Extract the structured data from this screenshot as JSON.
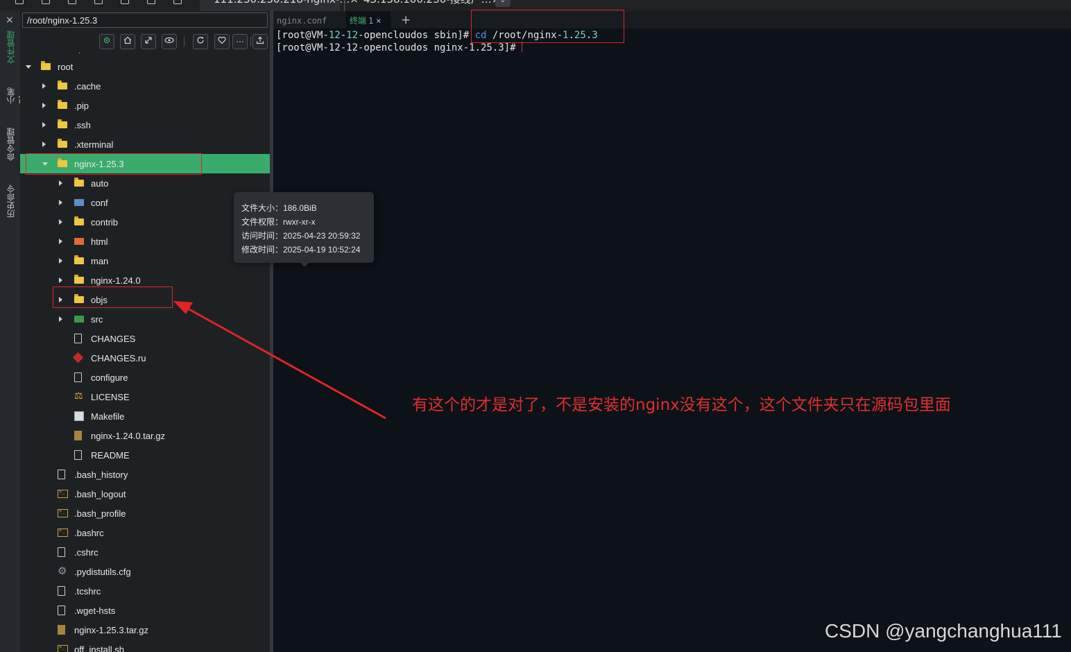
{
  "window_tabs": [
    {
      "label": "111.230.230.218-nginx-…×"
    },
    {
      "label": "43.138.100.230-接线厂…×"
    }
  ],
  "sidebar_rail": {
    "close_glyph": "×",
    "files_label": "文件管理",
    "notes_label": "小笔记",
    "commands_label": "命令管理",
    "history_label": "历史命令"
  },
  "file_panel": {
    "path": "/root/nginx-1.25.3",
    "toolbar_icons": [
      "locate-icon",
      "home-icon",
      "collapse-icon",
      "eye-icon",
      "refresh-icon",
      "heart-icon",
      "more-icon",
      "upload-icon"
    ],
    "tree": [
      {
        "label": "root",
        "icon": "folder-icon",
        "caret": "open",
        "depth": 0
      },
      {
        "label": ".cache",
        "icon": "folder-icon",
        "caret": "closed",
        "depth": 1
      },
      {
        "label": ".pip",
        "icon": "folder-icon",
        "caret": "closed",
        "depth": 1
      },
      {
        "label": ".ssh",
        "icon": "folder-icon",
        "caret": "closed",
        "depth": 1
      },
      {
        "label": ".xterminal",
        "icon": "folder-icon",
        "caret": "closed",
        "depth": 1
      },
      {
        "label": "nginx-1.25.3",
        "icon": "folder-icon",
        "caret": "open",
        "depth": 1,
        "selected": true
      },
      {
        "label": "auto",
        "icon": "folder-icon",
        "caret": "closed",
        "depth": 2
      },
      {
        "label": "conf",
        "icon": "conf-folder-icon",
        "caret": "closed",
        "depth": 2
      },
      {
        "label": "contrib",
        "icon": "folder-icon",
        "caret": "closed",
        "depth": 2
      },
      {
        "label": "html",
        "icon": "html-folder-icon",
        "caret": "closed",
        "depth": 2
      },
      {
        "label": "man",
        "icon": "folder-icon",
        "caret": "closed",
        "depth": 2
      },
      {
        "label": "nginx-1.24.0",
        "icon": "folder-icon",
        "caret": "closed",
        "depth": 2
      },
      {
        "label": "objs",
        "icon": "folder-icon",
        "caret": "closed",
        "depth": 2
      },
      {
        "label": "src",
        "icon": "src-folder-icon",
        "caret": "closed",
        "depth": 2
      },
      {
        "label": "CHANGES",
        "icon": "file-icon",
        "caret": "none",
        "depth": 2
      },
      {
        "label": "CHANGES.ru",
        "icon": "ruby-icon",
        "caret": "none",
        "depth": 2
      },
      {
        "label": "configure",
        "icon": "file-icon",
        "caret": "none",
        "depth": 2
      },
      {
        "label": "LICENSE",
        "icon": "license-icon",
        "caret": "none",
        "depth": 2
      },
      {
        "label": "Makefile",
        "icon": "makefile-icon",
        "caret": "none",
        "depth": 2
      },
      {
        "label": "nginx-1.24.0.tar.gz",
        "icon": "archive-icon",
        "caret": "none",
        "depth": 2
      },
      {
        "label": "README",
        "icon": "file-icon",
        "caret": "none",
        "depth": 2
      },
      {
        "label": ".bash_history",
        "icon": "file-icon",
        "caret": "none",
        "depth": 1
      },
      {
        "label": ".bash_logout",
        "icon": "shell-icon",
        "caret": "none",
        "depth": 1
      },
      {
        "label": ".bash_profile",
        "icon": "shell-icon",
        "caret": "none",
        "depth": 1
      },
      {
        "label": ".bashrc",
        "icon": "shell-icon",
        "caret": "none",
        "depth": 1
      },
      {
        "label": ".cshrc",
        "icon": "file-icon",
        "caret": "none",
        "depth": 1
      },
      {
        "label": ".pydistutils.cfg",
        "icon": "gear-icon",
        "caret": "none",
        "depth": 1
      },
      {
        "label": ".tcshrc",
        "icon": "file-icon",
        "caret": "none",
        "depth": 1
      },
      {
        "label": ".wget-hsts",
        "icon": "file-icon",
        "caret": "none",
        "depth": 1
      },
      {
        "label": "nginx-1.25.3.tar.gz",
        "icon": "archive-icon",
        "caret": "none",
        "depth": 1
      },
      {
        "label": "off_install.sh",
        "icon": "shell-icon",
        "caret": "none",
        "depth": 1
      }
    ]
  },
  "tooltip": {
    "size": "文件大小：186.0BiB",
    "perms": "文件权限：rwxr-xr-x",
    "accessed": "访问时间：2025-04-23 20:59:32",
    "modified": "修改时间：2025-04-19 10:52:24"
  },
  "terminal": {
    "tabs": {
      "conf": "nginx.conf",
      "term": "终端",
      "term_num": "1",
      "close": "×",
      "add": "+"
    },
    "line1": {
      "prompt_pre": "[root@VM-",
      "n1": "12",
      "d1": "-",
      "n2": "12",
      "prompt_post": "-opencloudos sbin]# ",
      "cmd": "cd",
      "arg_pre": " /root/nginx-",
      "ver1": "1",
      "dot1": ".",
      "ver2": "25",
      "dot2": ".",
      "ver3": "3"
    },
    "line2": "[root@VM-12-12-opencloudos nginx-1.25.3]#"
  },
  "annotation": {
    "text": "有这个的才是对了，不是安装的nginx没有这个，这个文件夹只在源码包里面",
    "color": "#e0302c"
  },
  "watermark": "CSDN @yangchanghua111",
  "colors": {
    "accent_green": "#39ac6c",
    "annotation_red": "#e02424"
  }
}
